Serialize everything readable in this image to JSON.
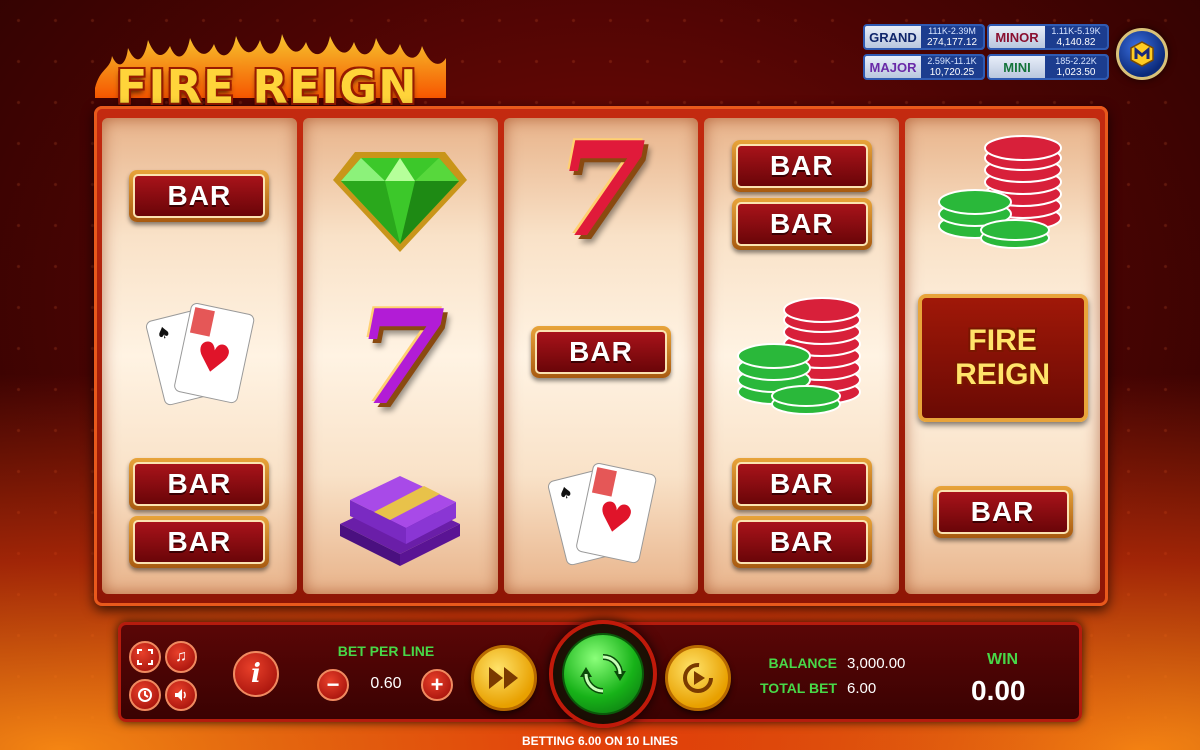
{
  "game": {
    "title": "FIRE REIGN"
  },
  "jackpots": {
    "grand": {
      "label": "GRAND",
      "range": "111K-2.39M",
      "amount": "274,177.12"
    },
    "minor": {
      "label": "MINOR",
      "range": "1.11K-5.19K",
      "amount": "4,140.82"
    },
    "major": {
      "label": "MAJOR",
      "range": "2.59K-11.1K",
      "amount": "10,720.25"
    },
    "mini": {
      "label": "MINI",
      "range": "185-2.22K",
      "amount": "1,023.50"
    }
  },
  "reels": [
    [
      "bar",
      "cards",
      "bar",
      "bar"
    ],
    [
      "diamond",
      "purple-seven",
      "cash"
    ],
    [
      "red-seven",
      "bar",
      "cards"
    ],
    [
      "bar",
      "bar",
      "chips",
      "bar",
      "bar"
    ],
    [
      "chips",
      "fire-reign",
      "bar"
    ]
  ],
  "symbols": {
    "bar_label": "BAR",
    "seven_label": "7",
    "fire_reign_line1": "FIRE",
    "fire_reign_line2": "REIGN"
  },
  "controls": {
    "bet_per_line_label": "BET PER LINE",
    "bet_per_line_value": "0.60",
    "minus": "−",
    "plus": "+",
    "info": "i",
    "balance_label": "BALANCE",
    "balance_value": "3,000.00",
    "total_bet_label": "TOTAL BET",
    "total_bet_value": "6.00",
    "win_label": "WIN",
    "win_value": "0.00"
  },
  "footer": {
    "betting_text": "BETTING 6.00 ON 10 LINES"
  },
  "colors": {
    "accent_green": "#48d848",
    "frame_red": "#c42a10",
    "gold": "#e8a43a"
  }
}
